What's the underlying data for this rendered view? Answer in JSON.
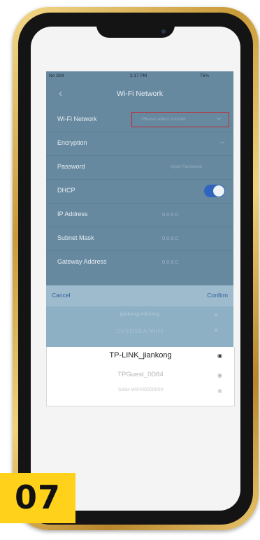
{
  "status_bar": {
    "carrier": "No SIM",
    "time": "2:17 PM",
    "battery": "76%"
  },
  "nav": {
    "title": "Wi-Fi Network",
    "back_icon": "chevron-left-icon"
  },
  "form": {
    "wifi_network_label": "Wi-Fi Network",
    "wifi_network_placeholder": "Please select a router",
    "encryption_label": "Encryption",
    "password_label": "Password",
    "password_placeholder": "Input Password",
    "dhcp_label": "DHCP",
    "dhcp_enabled": true,
    "ip_label": "IP Address",
    "ip_value": "0.0.0.0",
    "subnet_label": "Subnet Mask",
    "subnet_value": "0.0.0.0",
    "gateway_label": "Gateway Address",
    "gateway_value": "0.0.0.0"
  },
  "actions": {
    "cancel": "Cancel",
    "confirm": "Confirm"
  },
  "networks": [
    "jiankongceshirong",
    "OVERSEA-WIFI",
    "TP-LINK_jiankong",
    "TPGuest_0D84",
    "Solar-WIFI00000000"
  ],
  "badge": {
    "number": "07"
  },
  "colors": {
    "frame": "#d4a94a",
    "overlay": "#6789a0",
    "toggle": "#2f64bf",
    "highlight": "#c02a36",
    "badge": "#ffd11a"
  }
}
